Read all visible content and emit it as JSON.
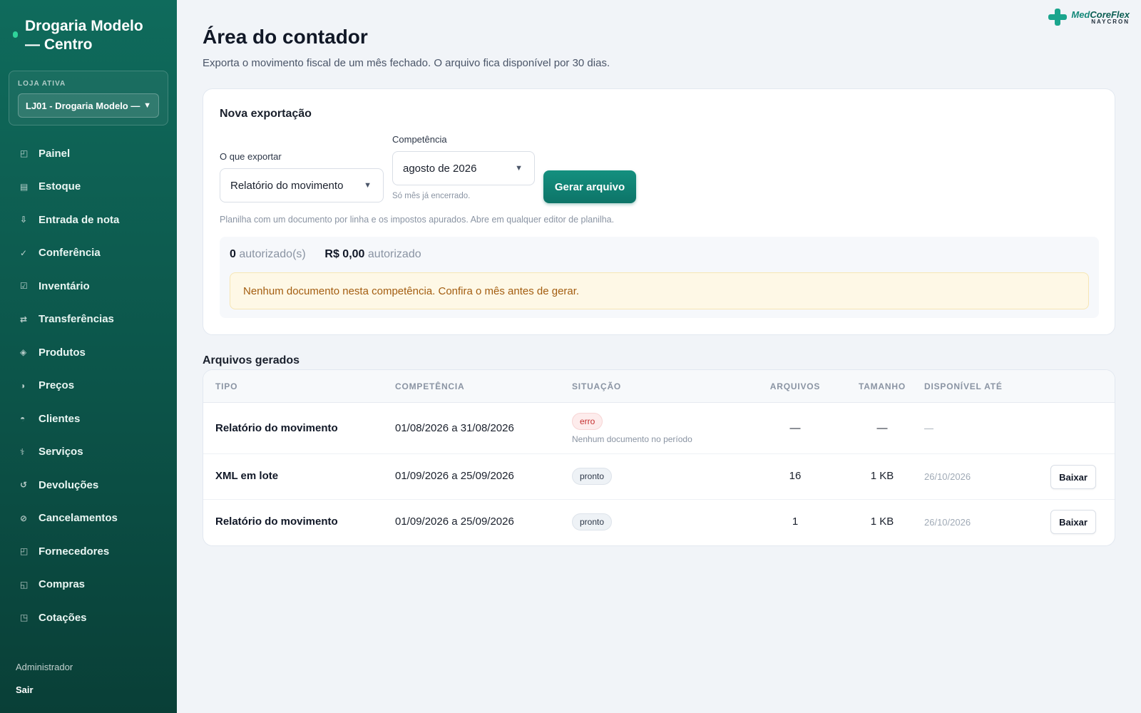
{
  "sidebar": {
    "brand": "Drogaria Modelo — Centro",
    "store_label": "LOJA ATIVA",
    "store_value": "LJ01 - Drogaria Modelo —",
    "items": [
      {
        "label": "Painel",
        "icon": "◰"
      },
      {
        "label": "Estoque",
        "icon": "▤"
      },
      {
        "label": "Entrada de nota",
        "icon": "⇩"
      },
      {
        "label": "Conferência",
        "icon": "✓"
      },
      {
        "label": "Inventário",
        "icon": "☑"
      },
      {
        "label": "Transferências",
        "icon": "⇄"
      },
      {
        "label": "Produtos",
        "icon": "◈"
      },
      {
        "label": "Preços",
        "icon": "◑"
      },
      {
        "label": "Clientes",
        "icon": "◓"
      },
      {
        "label": "Serviços",
        "icon": "⚕"
      },
      {
        "label": "Devoluções",
        "icon": "↺"
      },
      {
        "label": "Cancelamentos",
        "icon": "⊘"
      },
      {
        "label": "Fornecedores",
        "icon": "◰"
      },
      {
        "label": "Compras",
        "icon": "◱"
      },
      {
        "label": "Cotações",
        "icon": "◳"
      }
    ],
    "user": "Administrador",
    "logout": "Sair"
  },
  "logo": {
    "name_a": "Med",
    "name_b": "CoreFlex",
    "sub": "NAYCRON"
  },
  "page": {
    "title": "Área do contador",
    "subtitle": "Exporta o movimento fiscal de um mês fechado. O arquivo fica disponível por 30 dias."
  },
  "export": {
    "title": "Nova exportação",
    "what_label": "O que exportar",
    "what_value": "Relatório do movimento",
    "period_label": "Competência",
    "period_value": "agosto de 2026",
    "period_hint": "Só mês já encerrado.",
    "generate_button": "Gerar arquivo",
    "description": "Planilha com um documento por linha e os impostos apurados. Abre em qualquer editor de planilha.",
    "count_value": "0",
    "count_label": "autorizado(s)",
    "amount_value": "R$ 0,00",
    "amount_label": "autorizado",
    "warning": "Nenhum documento nesta competência. Confira o mês antes de gerar."
  },
  "files": {
    "title": "Arquivos gerados",
    "columns": [
      "TIPO",
      "COMPETÊNCIA",
      "SITUAÇÃO",
      "ARQUIVOS",
      "TAMANHO",
      "DISPONÍVEL ATÉ"
    ],
    "rows": [
      {
        "type": "Relatório do movimento",
        "period": "01/08/2026 a 31/08/2026",
        "status": "erro",
        "note": "Nenhum documento no período",
        "files": "—",
        "size": "—",
        "until": "—",
        "action": ""
      },
      {
        "type": "XML em lote",
        "period": "01/09/2026 a 25/09/2026",
        "status": "pronto",
        "note": "",
        "files": "16",
        "size": "1 KB",
        "until": "26/10/2026",
        "action": "Baixar"
      },
      {
        "type": "Relatório do movimento",
        "period": "01/09/2026 a 25/09/2026",
        "status": "pronto",
        "note": "",
        "files": "1",
        "size": "1 KB",
        "until": "26/10/2026",
        "action": "Baixar"
      }
    ]
  },
  "colors": {
    "sidebar": "#0f6b5c",
    "primary": "#0d7468",
    "warning_bg": "#fef8e6",
    "warning_text": "#a35d10",
    "error": "#c53030"
  }
}
